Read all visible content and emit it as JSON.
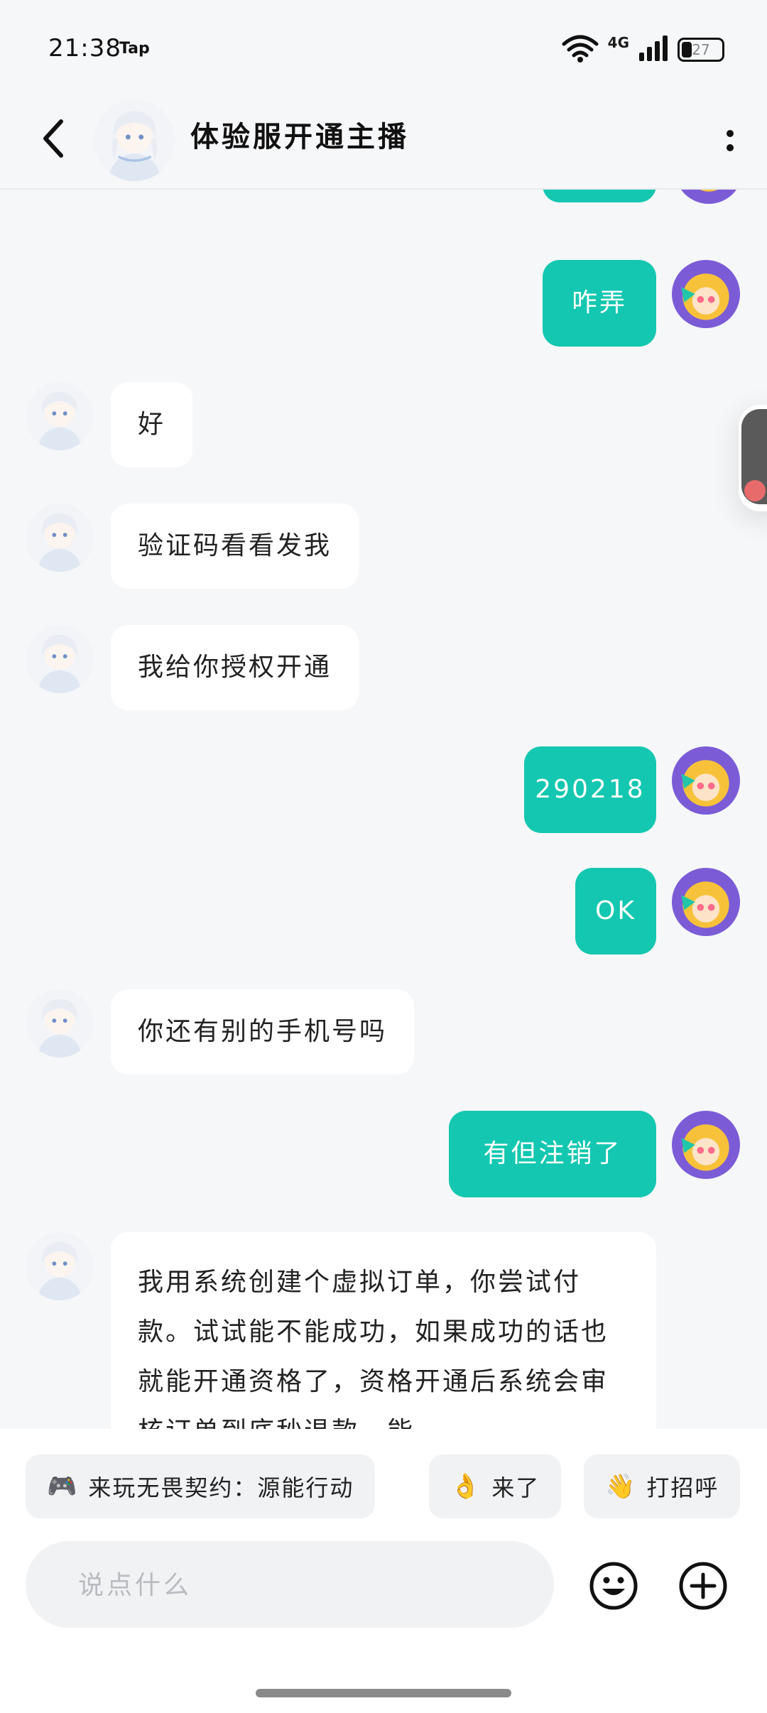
{
  "status_bar": {
    "time": "21:38",
    "app_label": "Tap",
    "network": "4G",
    "battery": "27"
  },
  "header": {
    "title": "体验服开通主播",
    "back_icon": "back-arrow-icon",
    "more_icon": "more-vertical-icon"
  },
  "colors": {
    "accent": "#14c7b1",
    "background": "#f6f7f9",
    "incoming_bubble": "#ffffff"
  },
  "messages": [
    {
      "sender": "me",
      "text": "咋弄"
    },
    {
      "sender": "other",
      "text": "好"
    },
    {
      "sender": "other",
      "text": "验证码看看发我"
    },
    {
      "sender": "other",
      "text": "我给你授权开通"
    },
    {
      "sender": "me",
      "text": "290218"
    },
    {
      "sender": "me",
      "text": "OK"
    },
    {
      "sender": "other",
      "text": "你还有别的手机号吗"
    },
    {
      "sender": "me",
      "text": "有但注销了"
    },
    {
      "sender": "other",
      "text": "我用系统创建个虚拟订单，你尝试付款。试试能不能成功，如果成功的话也就能开通资格了，资格开通后系统会审核订单到底秒退款，能"
    }
  ],
  "quick_replies": [
    {
      "emoji": "🎮",
      "label": "来玩无畏契约：源能行动"
    },
    {
      "emoji": "👌",
      "label": "来了"
    },
    {
      "emoji": "👋",
      "label": "打招呼"
    }
  ],
  "composer": {
    "placeholder": "说点什么",
    "emoji_icon": "emoji-icon",
    "plus_icon": "plus-circle-icon"
  }
}
